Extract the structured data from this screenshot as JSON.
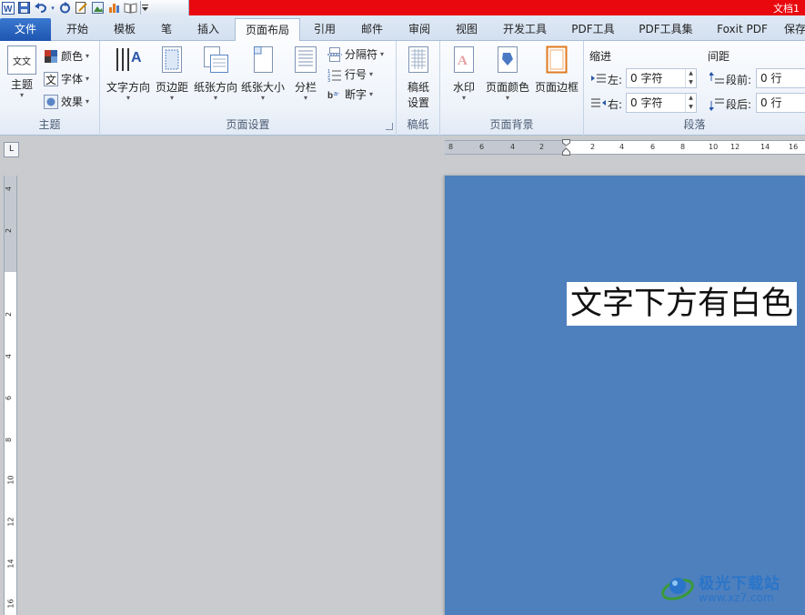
{
  "titlebar": {
    "app_title": "文档1"
  },
  "tabs": [
    {
      "label": "文件"
    },
    {
      "label": "开始"
    },
    {
      "label": "模板"
    },
    {
      "label": "笔"
    },
    {
      "label": "插入"
    },
    {
      "label": "页面布局"
    },
    {
      "label": "引用"
    },
    {
      "label": "邮件"
    },
    {
      "label": "审阅"
    },
    {
      "label": "视图"
    },
    {
      "label": "开发工具"
    },
    {
      "label": "PDF工具"
    },
    {
      "label": "PDF工具集"
    },
    {
      "label": "Foxit PDF"
    },
    {
      "label": "保存"
    }
  ],
  "ribbon": {
    "theme_group": {
      "label": "主题",
      "themes": "主题",
      "colors": "颜色",
      "fonts": "字体",
      "effects": "效果",
      "theme_icon_text": "文文"
    },
    "page_setup_group": {
      "label": "页面设置",
      "text_direction": "文字方向",
      "margins": "页边距",
      "orientation": "纸张方向",
      "size": "纸张大小",
      "columns": "分栏",
      "breaks": "分隔符",
      "line_numbers": "行号",
      "hyphenation": "断字"
    },
    "manuscript_group": {
      "label": "稿纸",
      "button_line1": "稿纸",
      "button_line2": "设置"
    },
    "background_group": {
      "label": "页面背景",
      "watermark": "水印",
      "page_color": "页面颜色",
      "page_borders": "页面边框"
    },
    "paragraph_group": {
      "label": "段落",
      "indent_title": "缩进",
      "spacing_title": "间距",
      "left_label": "左:",
      "left_value": "0 字符",
      "right_label": "右:",
      "right_value": "0 字符",
      "before_label": "段前:",
      "before_value": "0 行",
      "after_label": "段后:",
      "after_value": "0 行"
    }
  },
  "ruler": {
    "horizontal_ticks": [
      "8",
      "6",
      "4",
      "2",
      "2",
      "4",
      "6",
      "8",
      "10",
      "12",
      "14",
      "16"
    ],
    "vertical_ticks": [
      "4",
      "2",
      "2",
      "4",
      "6",
      "8",
      "10",
      "12",
      "14",
      "16"
    ]
  },
  "document": {
    "text": "文字下方有白色"
  },
  "watermark": {
    "line1": "极光下载站",
    "line2": "www.xz7.com"
  },
  "colors": {
    "title_red": "#e8080d",
    "page_blue": "#4e80bd",
    "file_tab_blue": "#2a63c0"
  }
}
